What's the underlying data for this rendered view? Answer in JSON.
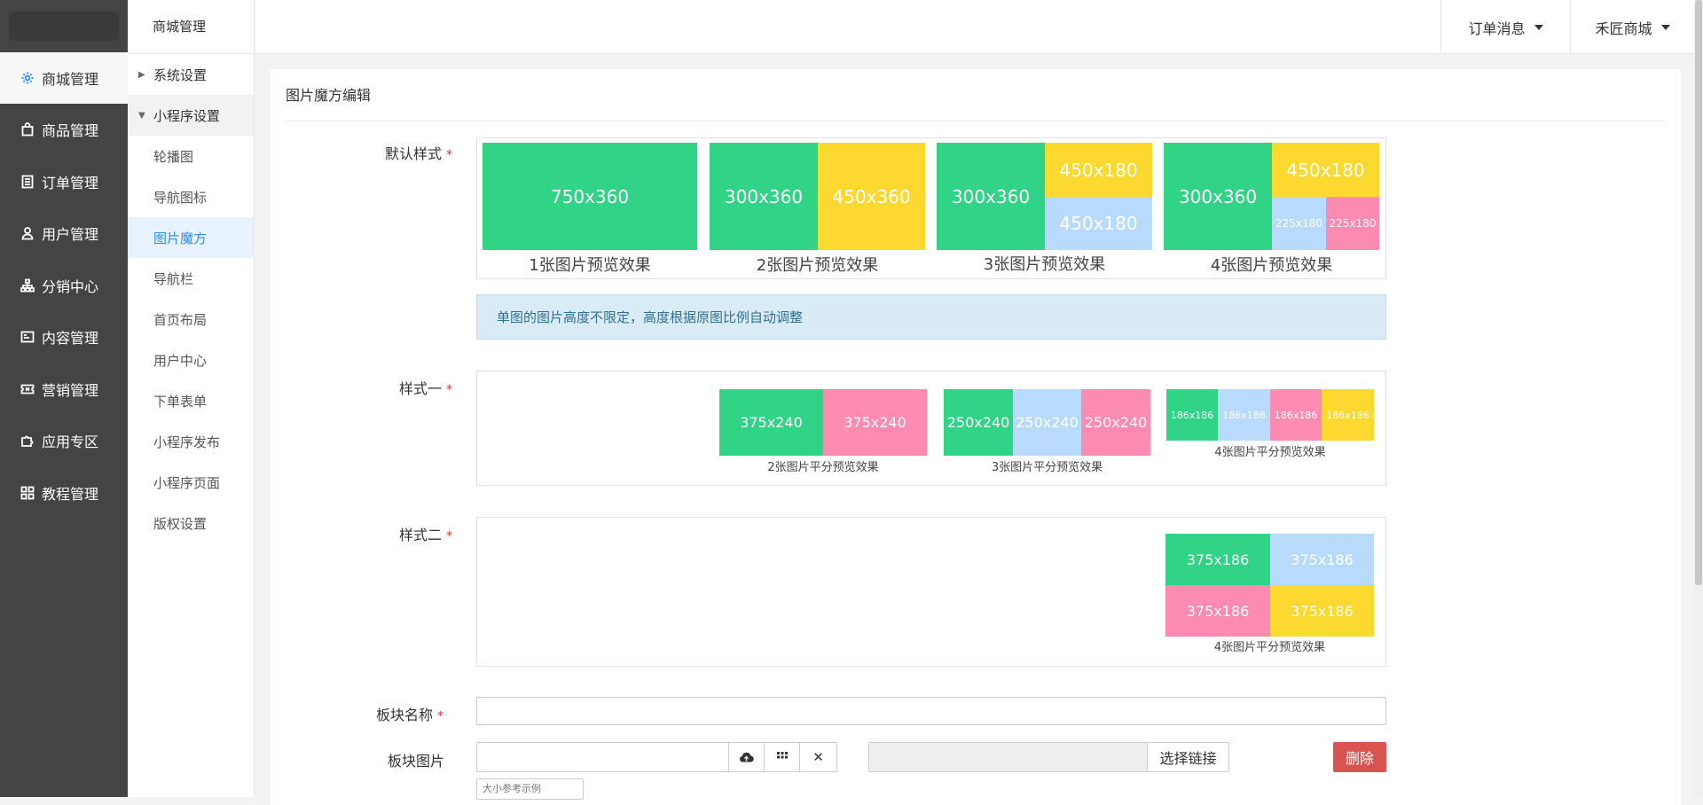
{
  "sidebar": {
    "items": [
      {
        "label": "商城管理",
        "icon": "gear-icon"
      },
      {
        "label": "商品管理",
        "icon": "bag-icon"
      },
      {
        "label": "订单管理",
        "icon": "list-icon"
      },
      {
        "label": "用户管理",
        "icon": "user-icon"
      },
      {
        "label": "分销中心",
        "icon": "sitemap-icon"
      },
      {
        "label": "内容管理",
        "icon": "doc-icon"
      },
      {
        "label": "营销管理",
        "icon": "ticket-icon"
      },
      {
        "label": "应用专区",
        "icon": "puzzle-icon"
      },
      {
        "label": "教程管理",
        "icon": "grid-icon"
      }
    ]
  },
  "subnav": {
    "title": "商城管理",
    "items": [
      {
        "label": "系统设置"
      },
      {
        "label": "小程序设置"
      },
      {
        "label": "轮播图"
      },
      {
        "label": "导航图标"
      },
      {
        "label": "图片魔方"
      },
      {
        "label": "导航栏"
      },
      {
        "label": "首页布局"
      },
      {
        "label": "用户中心"
      },
      {
        "label": "下单表单"
      },
      {
        "label": "小程序发布"
      },
      {
        "label": "小程序页面"
      },
      {
        "label": "版权设置"
      }
    ]
  },
  "topbar": {
    "order_msg": "订单消息",
    "shop": "禾匠商城"
  },
  "panel": {
    "title": "图片魔方编辑"
  },
  "form": {
    "default_style": {
      "label": "默认样式",
      "tiles": {
        "t1": "750x360",
        "t2a": "300x360",
        "t2b": "450x360",
        "t3a": "300x360",
        "t3b": "450x180",
        "t3c": "450x180",
        "t4a": "300x360",
        "t4b": "450x180",
        "t4c": "225x180",
        "t4d": "225x180"
      },
      "captions": [
        "1张图片预览效果",
        "2张图片预览效果",
        "3张图片预览效果",
        "4张图片预览效果"
      ]
    },
    "tip": "单图的图片高度不限定，高度根据原图比例自动调整",
    "style1": {
      "label": "样式一",
      "tiles": {
        "a1": "375x240",
        "a2": "375x240",
        "b1": "250x240",
        "b2": "250x240",
        "b3": "250x240",
        "c1": "186x186",
        "c2": "186x186",
        "c3": "186x186",
        "c4": "186x186"
      },
      "captions": [
        "2张图片平分预览效果",
        "3张图片平分预览效果",
        "4张图片平分预览效果"
      ]
    },
    "style2": {
      "label": "样式二",
      "tiles": {
        "a": "375x186",
        "b": "375x186",
        "c": "375x186",
        "d": "375x186"
      },
      "caption": "4张图片平分预览效果"
    },
    "block_name": {
      "label": "板块名称",
      "value": ""
    },
    "block_image": {
      "label": "板块图片",
      "size_hint": "大小参考示例"
    },
    "link_button": "选择链接",
    "delete_button": "删除"
  },
  "colors": {
    "green": "#31d386",
    "yellow": "#fbd930",
    "blue": "#b9dbfb",
    "pink": "#fb8bb0",
    "accent": "#2d8cf0",
    "danger": "#d9534f"
  }
}
